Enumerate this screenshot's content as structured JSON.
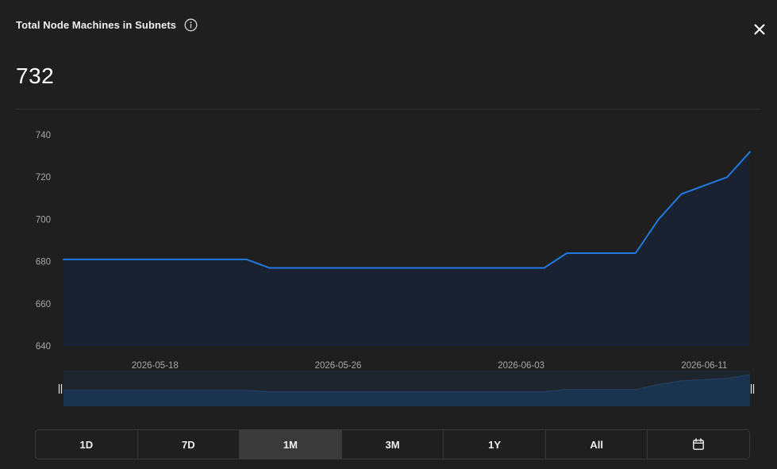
{
  "header": {
    "title": "Total Node Machines in Subnets",
    "info_icon": "info-icon",
    "close_icon": "close-icon"
  },
  "current_value": "732",
  "range_selector": {
    "options": [
      "1D",
      "7D",
      "1M",
      "3M",
      "1Y",
      "All"
    ],
    "active": "1M",
    "calendar_icon": "calendar-icon"
  },
  "colors": {
    "line": "#1f7ae0",
    "area": "#1a2130",
    "background": "#1f1f1f"
  },
  "chart_data": {
    "type": "area",
    "x_tick_labels": [
      "2026-05-18",
      "2026-05-26",
      "2026-06-03",
      "2026-06-11"
    ],
    "y_tick_labels": [
      "740",
      "720",
      "700",
      "680",
      "660",
      "640"
    ],
    "ylim": [
      640,
      740
    ],
    "x_range": [
      "2026-05-14",
      "2026-06-13"
    ],
    "grid": false,
    "series": [
      {
        "points": [
          {
            "x": "2026-05-14",
            "y": 681
          },
          {
            "x": "2026-05-22",
            "y": 681
          },
          {
            "x": "2026-05-23",
            "y": 677
          },
          {
            "x": "2026-06-04",
            "y": 677
          },
          {
            "x": "2026-06-05",
            "y": 684
          },
          {
            "x": "2026-06-08",
            "y": 684
          },
          {
            "x": "2026-06-09",
            "y": 700
          },
          {
            "x": "2026-06-10",
            "y": 712
          },
          {
            "x": "2026-06-12",
            "y": 720
          },
          {
            "x": "2026-06-13",
            "y": 732
          }
        ]
      }
    ],
    "navigator": true
  }
}
